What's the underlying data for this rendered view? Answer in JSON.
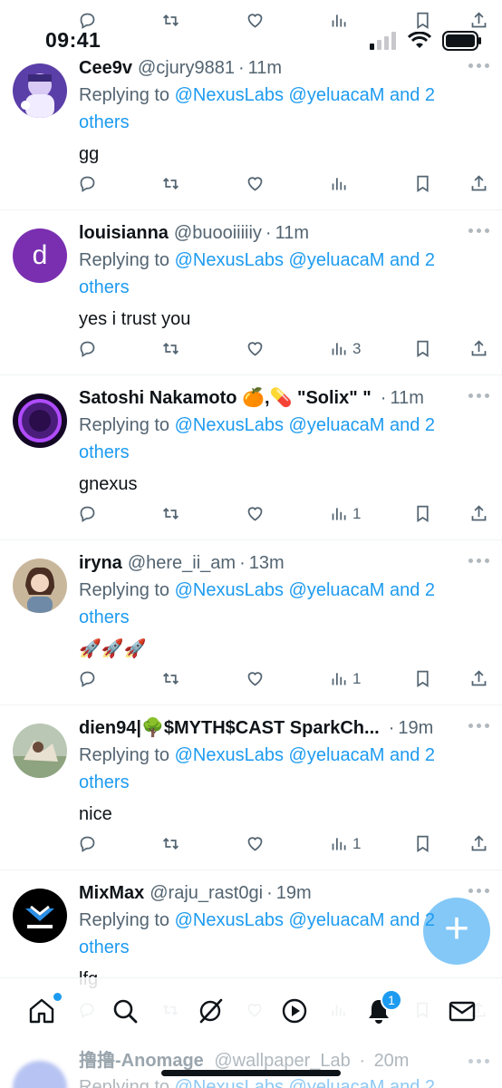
{
  "status_bar": {
    "time": "09:41"
  },
  "tweets": [
    {
      "name": "Cee9v",
      "handle": "@cjury9881",
      "time": "11m",
      "reply_prefix": "Replying to",
      "mentions": "@NexusLabs @yeluacaM and 2 others",
      "text": "gg",
      "views": ""
    },
    {
      "name": "louisianna",
      "handle": "@buooiiiiiy",
      "time": "11m",
      "reply_prefix": "Replying to",
      "mentions": "@NexusLabs @yeluacaM and 2 others",
      "text": "yes i trust you",
      "views": "3",
      "avatar_letter": "d"
    },
    {
      "name": "Satoshi Nakamoto 🍊,💊 \"Solix\" \"",
      "handle": "",
      "time": "11m",
      "reply_prefix": "Replying to",
      "mentions": "@NexusLabs @yeluacaM and 2 others",
      "text": "gnexus",
      "views": "1"
    },
    {
      "name": "iryna",
      "handle": "@here_ii_am",
      "time": "13m",
      "reply_prefix": "Replying to",
      "mentions": "@NexusLabs @yeluacaM and 2 others",
      "text": "🚀🚀🚀",
      "views": "1"
    },
    {
      "name": "dien94|🌳$MYTH$CAST SparkCh...",
      "handle": "",
      "time": "19m",
      "reply_prefix": "Replying to",
      "mentions": "@NexusLabs @yeluacaM and 2 others",
      "text": "nice",
      "views": "1"
    },
    {
      "name": "MixMax",
      "handle": "@raju_rast0gi",
      "time": "19m",
      "reply_prefix": "Replying to",
      "mentions": "@NexusLabs @yeluacaM and 2 others",
      "text": "lfg",
      "views": ""
    }
  ],
  "last_tweet": {
    "name": "撸撸-Anomage",
    "handle": "@wallpaper_Lab",
    "time": "20m",
    "reply_prefix": "Replying to",
    "mentions": "@NexusLabs @yeluacaM and 2"
  },
  "bottom_nav": {
    "notifications_badge": "1"
  },
  "fab": {
    "label": "+"
  },
  "colors": {
    "accent": "#1d9bf0",
    "muted": "#536471",
    "text": "#0f1419"
  }
}
